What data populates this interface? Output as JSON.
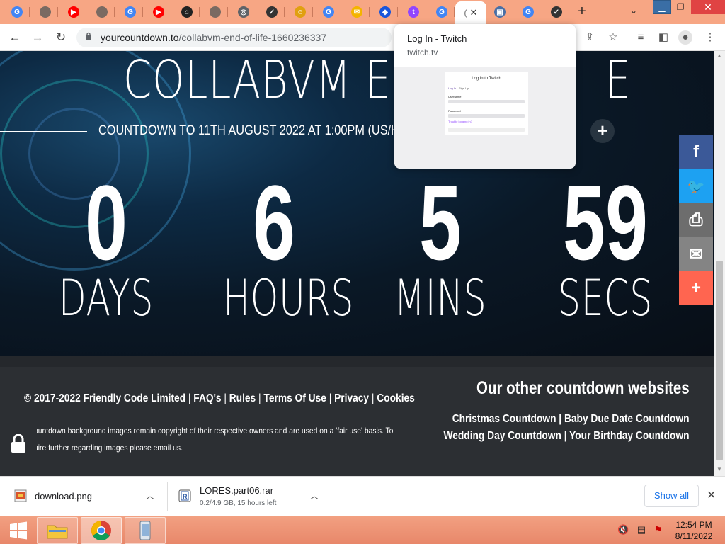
{
  "browser": {
    "url_domain": "yourcountdown.to",
    "url_path": "/collabvm-end-of-life-1660236337",
    "tabs": [
      {
        "icon": "google-icon",
        "color": "#4285f4",
        "glyph": "G"
      },
      {
        "icon": "globe-icon",
        "color": "#7a6a62",
        "glyph": ""
      },
      {
        "icon": "youtube-icon",
        "color": "#ff0000",
        "glyph": "▶"
      },
      {
        "icon": "globe-icon",
        "color": "#7a6a62",
        "glyph": ""
      },
      {
        "icon": "google-icon",
        "color": "#4285f4",
        "glyph": "G"
      },
      {
        "icon": "youtube-icon",
        "color": "#ff0000",
        "glyph": "▶"
      },
      {
        "icon": "app-icon",
        "color": "#222222",
        "glyph": "⌂"
      },
      {
        "icon": "globe-icon",
        "color": "#7a6a62",
        "glyph": ""
      },
      {
        "icon": "chrome-icon",
        "color": "#5f6368",
        "glyph": "◎"
      },
      {
        "icon": "dark-circle-icon",
        "color": "#333333",
        "glyph": "✓"
      },
      {
        "icon": "yellow-circle-icon",
        "color": "#e0a010",
        "glyph": "☺"
      },
      {
        "icon": "google-icon",
        "color": "#4285f4",
        "glyph": "G"
      },
      {
        "icon": "mail-icon",
        "color": "#f4b400",
        "glyph": "✉"
      },
      {
        "icon": "blue-logo-icon",
        "color": "#1a56db",
        "glyph": "◆"
      },
      {
        "icon": "twitch-icon",
        "color": "#9146ff",
        "glyph": "t"
      },
      {
        "icon": "google-icon",
        "color": "#4285f4",
        "glyph": "G"
      }
    ],
    "tabs_after": [
      {
        "icon": "image-icon",
        "color": "#4a6fa5",
        "glyph": "▣"
      },
      {
        "icon": "google-icon",
        "color": "#4285f4",
        "glyph": "G"
      },
      {
        "icon": "dark-circle-icon",
        "color": "#333333",
        "glyph": "✓"
      }
    ]
  },
  "hover_card": {
    "title": "Log In - Twitch",
    "domain": "twitch.tv",
    "preview_title": "Log in to Twitch",
    "preview_tab_login": "Log In",
    "preview_tab_signup": "Sign Up",
    "preview_username": "Username",
    "preview_password": "Password",
    "preview_trouble": "Trouble logging in?"
  },
  "countdown": {
    "title": "COLLABVM EN",
    "title_tail": "E",
    "subtitle": "COUNTDOWN TO 11TH AUGUST 2022 AT 1:00PM (US/HAWAI",
    "units": [
      {
        "value": "0",
        "label": "DAYS"
      },
      {
        "value": "6",
        "label": "HOURS"
      },
      {
        "value": "5",
        "label": "MINS"
      },
      {
        "value": "59",
        "label": "SECS"
      }
    ]
  },
  "share": [
    {
      "icon": "facebook-icon",
      "color": "#3b5998",
      "glyph": "f"
    },
    {
      "icon": "twitter-icon",
      "color": "#1da1f2",
      "glyph": "🐦"
    },
    {
      "icon": "print-icon",
      "color": "#6d6d6d",
      "glyph": "⎙"
    },
    {
      "icon": "email-icon",
      "color": "#848484",
      "glyph": "✉"
    },
    {
      "icon": "more-plus-icon",
      "color": "#ff6550",
      "glyph": "+"
    }
  ],
  "footer": {
    "copyright": "© 2017-2022 Friendly Code Limited",
    "links": [
      "FAQ's",
      "Rules",
      "Terms Of Use",
      "Privacy",
      "Cookies"
    ],
    "note_line1": "ountdown background images remain copyright of their respective owners and are used on a 'fair use' basis. To",
    "note_line2": "uire further regarding images please email us.",
    "other_title": "Our other countdown websites",
    "other_line1": "Christmas Countdown | Baby Due Date Countdown",
    "other_line2": "Wedding Day Countdown | Your Birthday Countdown"
  },
  "downloads": {
    "items": [
      {
        "name": "download.png",
        "status": ""
      },
      {
        "name": "LORES.part06.rar",
        "status": "0.2/4.9 GB, 15 hours left"
      }
    ],
    "show_all": "Show all"
  },
  "taskbar": {
    "time": "12:54 PM",
    "date": "8/11/2022"
  }
}
